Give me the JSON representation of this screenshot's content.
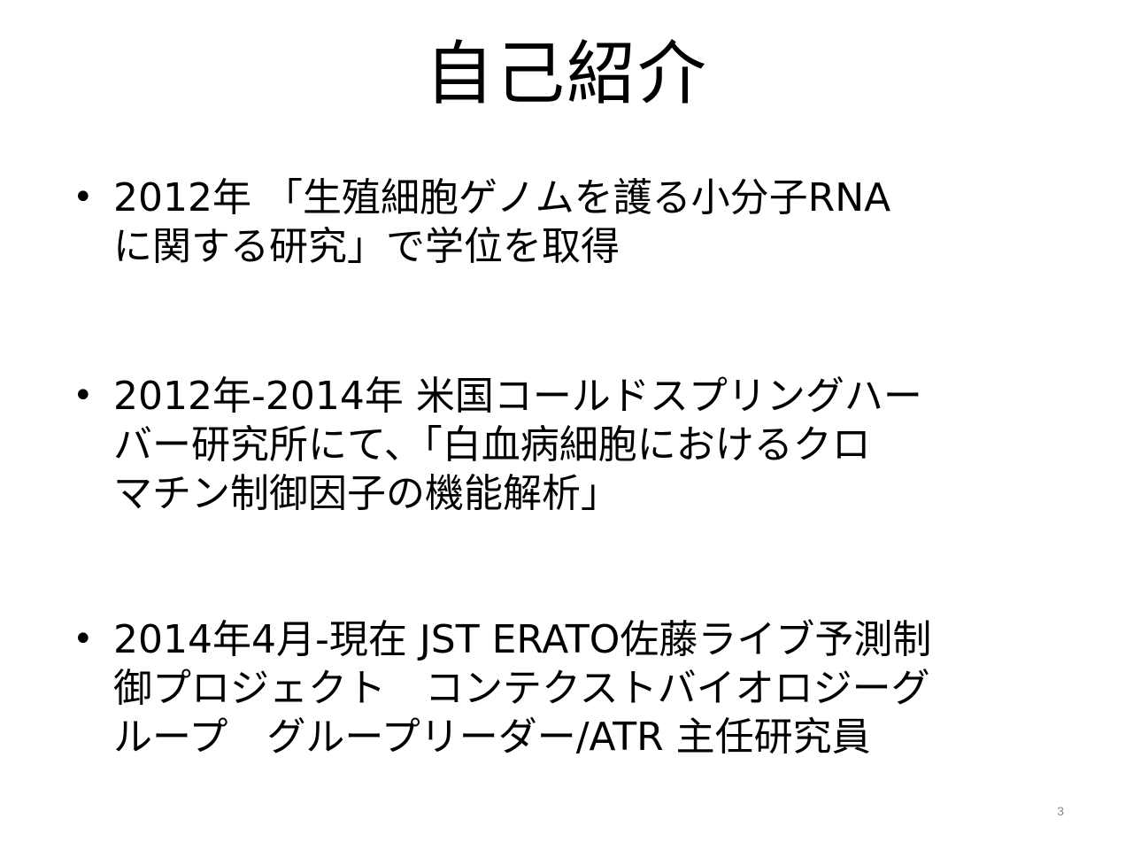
{
  "slide": {
    "title": "自己紹介",
    "bullet_symbol": "•",
    "bullets": [
      {
        "lines": [
          "2012年 「生殖細胞ゲノムを護る小分子RNA",
          "に関する研究」で学位を取得"
        ]
      },
      {
        "lines": [
          "2012年-2014年 米国コールドスプリングハー",
          "バー研究所にて、「白血病細胞におけるクロ",
          "マチン制御因子の機能解析」"
        ]
      },
      {
        "lines": [
          "2014年4月-現在 JST ERATO佐藤ライブ予測制",
          "御プロジェクト　コンテクストバイオロジーグ",
          "ループ　グループリーダー/ATR 主任研究員"
        ]
      }
    ],
    "page_number": "3"
  }
}
